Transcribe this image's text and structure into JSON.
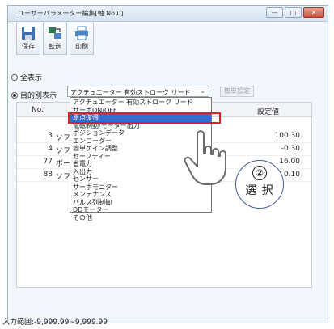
{
  "window": {
    "title": "ユーザーパラメーター編集[軸 No.0]",
    "buttons": [
      "—",
      "□",
      "✕"
    ]
  },
  "toolbar": {
    "save_label": "保存",
    "transfer_label": "転送",
    "print_label": "印刷"
  },
  "view": {
    "all_label": "全表示",
    "purpose_label": "目的別表示",
    "selected_option": "アクチュエーター 有効ストローク リード",
    "simple_setting_label": "簡単設定"
  },
  "table": {
    "col_no": "No.",
    "col_value": "設定値",
    "rows": [
      {
        "no": "3",
        "name": "ソフト",
        "value": "100.30"
      },
      {
        "no": "4",
        "name": "ソフト",
        "value": "-0.30"
      },
      {
        "no": "77",
        "name": "ボール",
        "value": "16.00"
      },
      {
        "no": "88",
        "name": "ソフト",
        "value": "0.10"
      }
    ]
  },
  "dropdown": {
    "items": [
      "アクチュエーター 有効ストローク リード",
      "サーボON/OFF",
      "原点復帰",
      "電磁制動/モーター出力",
      "ポジションデータ",
      "エンコーダー",
      "簡単ゲイン調整",
      "セーフティー",
      "省電力",
      "入出力",
      "センサー",
      "サーボモニター",
      "メンテナンス",
      "パルス列制御",
      "DDモーター",
      "その他"
    ],
    "highlighted_index": 2
  },
  "status": {
    "range_text": "入力範囲:-9,999.99~9,999.99"
  },
  "callout": {
    "step": "②",
    "text": "選 択"
  },
  "colors": {
    "highlight": "#2d6fd6",
    "annotation_red": "#e0201c"
  }
}
